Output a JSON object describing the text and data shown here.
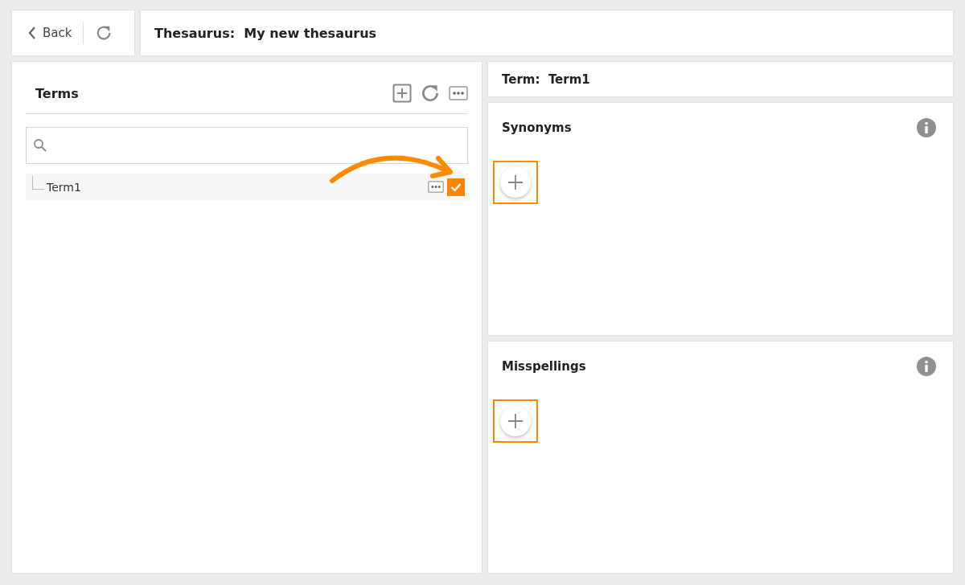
{
  "nav": {
    "back": "Back"
  },
  "title": "Thesaurus:  My new thesaurus",
  "terms_panel": {
    "title": "Terms",
    "items": [
      {
        "label": "Term1",
        "checked": true
      }
    ]
  },
  "term_header": "Term:  Term1",
  "sections": [
    {
      "title": "Synonyms",
      "add_highlighted": true
    },
    {
      "title": "Misspellings",
      "add_highlighted": true
    }
  ]
}
